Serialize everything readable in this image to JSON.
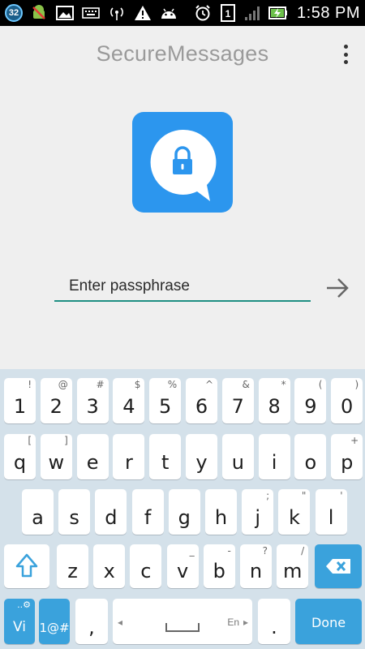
{
  "status_bar": {
    "notification_count": "32",
    "time": "1:58 PM",
    "sim_slot": "1"
  },
  "app": {
    "title": "SecureMessages"
  },
  "passphrase": {
    "placeholder": "Enter passphrase"
  },
  "keyboard": {
    "row1": [
      {
        "k": "1",
        "h": "!"
      },
      {
        "k": "2",
        "h": "@"
      },
      {
        "k": "3",
        "h": "#"
      },
      {
        "k": "4",
        "h": "$"
      },
      {
        "k": "5",
        "h": "%"
      },
      {
        "k": "6",
        "h": "^"
      },
      {
        "k": "7",
        "h": "&"
      },
      {
        "k": "8",
        "h": "*"
      },
      {
        "k": "9",
        "h": "("
      },
      {
        "k": "0",
        "h": ")"
      }
    ],
    "row2": [
      {
        "k": "q",
        "h": "["
      },
      {
        "k": "w",
        "h": "]"
      },
      {
        "k": "e",
        "h": ""
      },
      {
        "k": "r",
        "h": ""
      },
      {
        "k": "t",
        "h": ""
      },
      {
        "k": "y",
        "h": ""
      },
      {
        "k": "u",
        "h": ""
      },
      {
        "k": "i",
        "h": ""
      },
      {
        "k": "o",
        "h": ""
      },
      {
        "k": "p",
        "h": "+"
      }
    ],
    "row3": [
      {
        "k": "a",
        "h": ""
      },
      {
        "k": "s",
        "h": ""
      },
      {
        "k": "d",
        "h": ""
      },
      {
        "k": "f",
        "h": ""
      },
      {
        "k": "g",
        "h": ""
      },
      {
        "k": "h",
        "h": ""
      },
      {
        "k": "j",
        "h": ";"
      },
      {
        "k": "k",
        "h": "\""
      },
      {
        "k": "l",
        "h": "'"
      }
    ],
    "row4": [
      {
        "k": "z",
        "h": ""
      },
      {
        "k": "x",
        "h": ""
      },
      {
        "k": "c",
        "h": ""
      },
      {
        "k": "v",
        "h": "_"
      },
      {
        "k": "b",
        "h": "-"
      },
      {
        "k": "n",
        "h": "?"
      },
      {
        "k": "m",
        "h": "/"
      }
    ],
    "lang_key": "Vi",
    "lang_key_hint": "..⚙",
    "symbols_key": "1@#",
    "comma_key": ",",
    "space_label": "En",
    "space_left_arrow": "◂",
    "space_right_arrow": "▸",
    "period_key": ".",
    "done_key": "Done"
  },
  "colors": {
    "logo_blue": "#2c96ee",
    "input_underline": "#1f8f83",
    "keyboard_bg": "#d4e1ea",
    "accent_key": "#3aa2dc"
  }
}
